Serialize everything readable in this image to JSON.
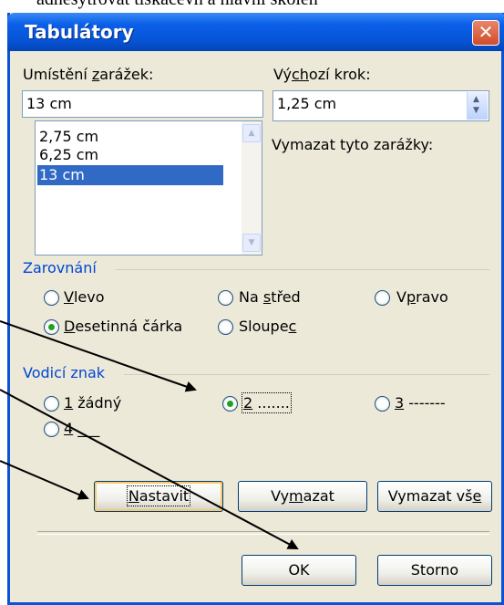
{
  "background_text": "     adnesytrovat tiskačevh a hlavní skoleh",
  "dialog": {
    "title": "Tabulátory",
    "close_glyph": "✕",
    "tab_position": {
      "label_pre": "Umístění ",
      "label_u": "z",
      "label_post": "arážek:",
      "value": "13 cm",
      "items": [
        "2,75 cm",
        "6,25 cm",
        "13 cm"
      ],
      "selected": "13 cm"
    },
    "default_step": {
      "label_pre": "Vý",
      "label_u": "ch",
      "label_post": "ozí krok:",
      "value": "1,25 cm"
    },
    "clear_label": "Vymazat tyto zarážky:",
    "alignment": {
      "title": "Zarovnání",
      "options": [
        {
          "pre": "",
          "u": "V",
          "post": "levo"
        },
        {
          "pre": "Na ",
          "u": "s",
          "post": "třed"
        },
        {
          "pre": "V",
          "u": "p",
          "post": "ravo"
        },
        {
          "pre": "",
          "u": "D",
          "post": "esetinná čárka"
        },
        {
          "pre": "Sloupe",
          "u": "c",
          "post": ""
        }
      ],
      "selected": "Desetinná čárka"
    },
    "leader": {
      "title": "Vodicí znak",
      "options": [
        {
          "u": "1",
          "post": " žádný"
        },
        {
          "u": "2",
          "post": " ......."
        },
        {
          "u": "3",
          "post": " -------"
        },
        {
          "u": "4",
          "post": " ___"
        }
      ],
      "selected": "2 ......."
    },
    "buttons": {
      "set": {
        "pre": "",
        "u": "N",
        "post": "astavit"
      },
      "clear": {
        "pre": "Vy",
        "u": "m",
        "post": "azat"
      },
      "clear_all": {
        "pre": "Vymazat vš",
        "u": "e",
        "post": ""
      },
      "ok": "OK",
      "cancel": "Storno"
    }
  },
  "colors": {
    "dialog_bg": "#ece9d8",
    "title_bar": "#0653d4",
    "group_title": "#0046d5",
    "selection": "#316ac5",
    "radio_dot": "#21a121",
    "close_button": "#d24a2a"
  }
}
